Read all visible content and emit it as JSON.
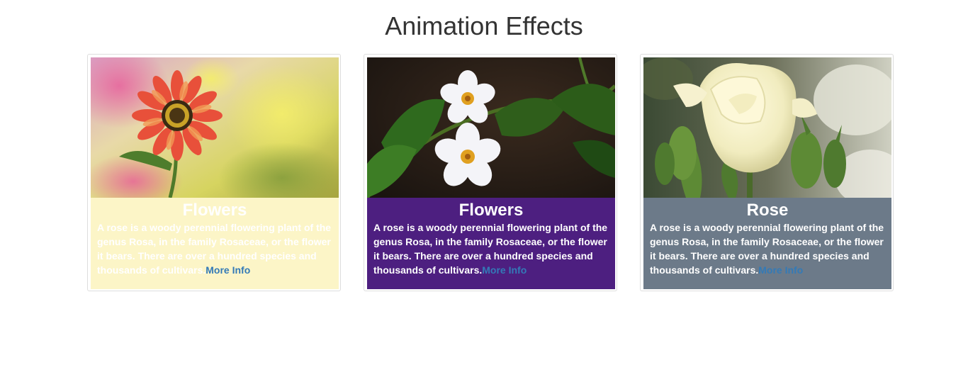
{
  "page": {
    "title": "Animation Effects"
  },
  "cards": [
    {
      "title": "Flowers",
      "text": "A rose is a woody perennial flowering plant of the genus Rosa, in the family Rosaceae, or the flower it bears. There are over a hundred species and thousands of cultivars.",
      "link_label": "More Info",
      "caption_color": "#fcf5c7",
      "image_subject": "orange-daisy-photo"
    },
    {
      "title": "Flowers",
      "text": "A rose is a woody perennial flowering plant of the genus Rosa, in the family Rosaceae, or the flower it bears. There are over a hundred species and thousands of cultivars.",
      "link_label": "More Info",
      "caption_color": "#4d1f80",
      "image_subject": "white-flowers-photo"
    },
    {
      "title": "Rose",
      "text": "A rose is a woody perennial flowering plant of the genus Rosa, in the family Rosaceae, or the flower it bears. There are over a hundred species and thousands of cultivars.",
      "link_label": "More Info",
      "caption_color": "#6c7a89",
      "image_subject": "white-rose-photo"
    }
  ],
  "colors": {
    "link": "#337ab7",
    "title_text": "#333333",
    "caption_text": "#ffffff"
  }
}
